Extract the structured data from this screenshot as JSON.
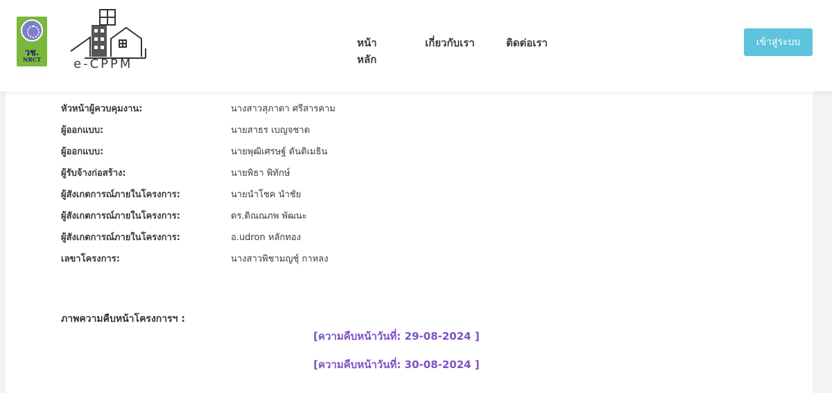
{
  "header": {
    "nrct_logo_text": [
      "วช.",
      "NRCT"
    ],
    "brand": "e-CPPM",
    "nav": [
      "หน้าหลัก",
      "เกี่ยวกับเรา",
      "ติดต่อเรา"
    ],
    "login_label": "เข้าสู่ระบบ",
    "accent_color": "#5ec3dc"
  },
  "details": [
    {
      "label": "หัวหน้าผู้ควบคุมงาน:",
      "value": "นางสาวสุภาดา ศรีสารคาม"
    },
    {
      "label": "ผู้ออกแบบ:",
      "value": "นายสาธร เบญจชาด"
    },
    {
      "label": "ผู้ออกแบบ:",
      "value": "นายพุฒิเศรษฐ์ ตันติเมธิน"
    },
    {
      "label": "ผู้รับจ้างก่อสร้าง:",
      "value": "นายพิธา พิทักษ์"
    },
    {
      "label": "ผู้สังเกตการณ์ภายในโครงการ:",
      "value": "นายนำโชค นำชัย"
    },
    {
      "label": "ผู้สังเกตการณ์ภายในโครงการ:",
      "value": "ดร.ดิณณภพ พัฒนะ"
    },
    {
      "label": "ผู้สังเกตการณ์ภายในโครงการ:",
      "value": "อ.udron หลักทอง"
    },
    {
      "label": "เลขาโครงการ:",
      "value": "นางสาวพิชามญชุ์ กาหลง"
    }
  ],
  "progress": {
    "title": "ภาพความคืบหน้าโครงการฯ :",
    "links": [
      "[ความคืบหน้าวันที่: 29-08-2024 ]",
      "[ความคืบหน้าวันที่: 30-08-2024 ]"
    ],
    "link_color": "#7b52c7"
  }
}
